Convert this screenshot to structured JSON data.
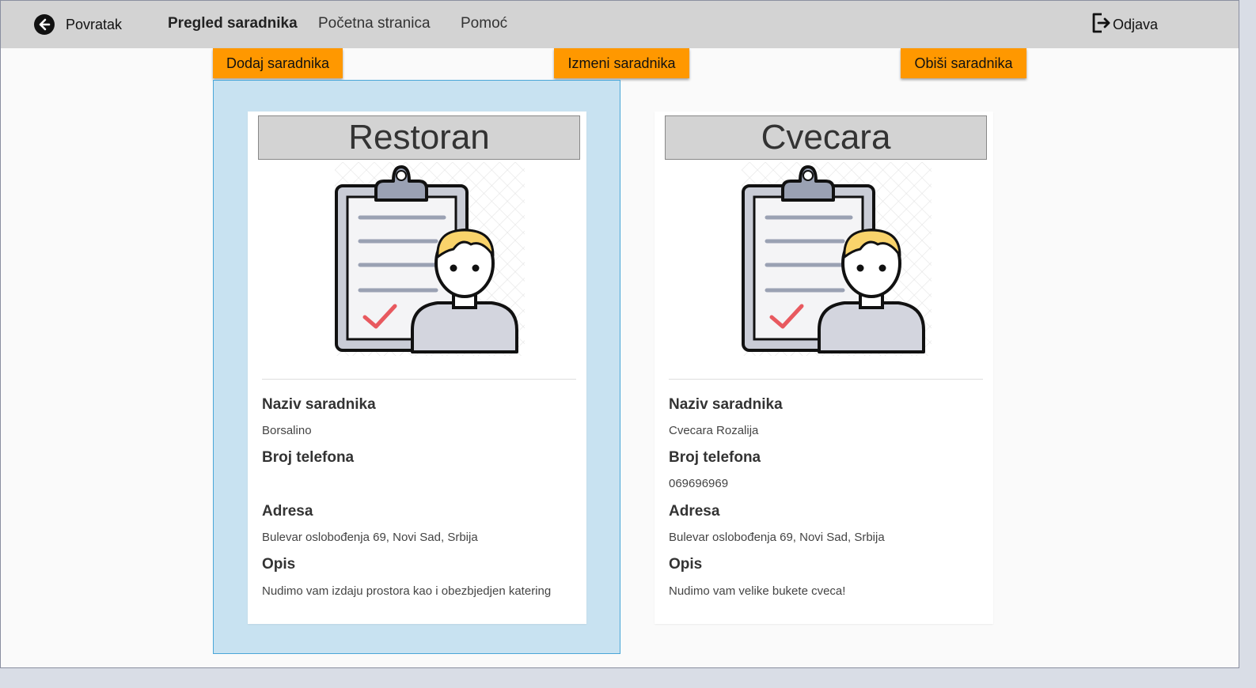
{
  "navbar": {
    "back_label": "Povratak",
    "links": [
      "Pregled saradnika",
      "Početna stranica",
      "Pomoć"
    ],
    "logout_label": "Odjava"
  },
  "actions": {
    "add": "Dodaj saradnika",
    "edit": "Izmeni saradnika",
    "delete": "Obiši saradnika"
  },
  "colors": {
    "accent": "#ff9800",
    "selected_bg": "#c8e2f1",
    "navbar_bg": "#d3d3d3"
  },
  "labels": {
    "name": "Naziv saradnika",
    "phone": "Broj telefona",
    "address": "Adresa",
    "description": "Opis"
  },
  "cards": [
    {
      "category": "Restoran",
      "name": "Borsalino",
      "phone": "",
      "address": "Bulevar oslobođenja 69, Novi Sad, Srbija",
      "description": "Nudimo vam izdaju prostora kao i obezbjedjen katering",
      "selected": true,
      "icon": "clipboard-person-illustration"
    },
    {
      "category": "Cvecara",
      "name": "Cvecara Rozalija",
      "phone": "069696969",
      "address": "Bulevar oslobođenja 69, Novi Sad, Srbija",
      "description": "Nudimo vam velike bukete cveca!",
      "selected": false,
      "icon": "clipboard-person-illustration"
    }
  ]
}
